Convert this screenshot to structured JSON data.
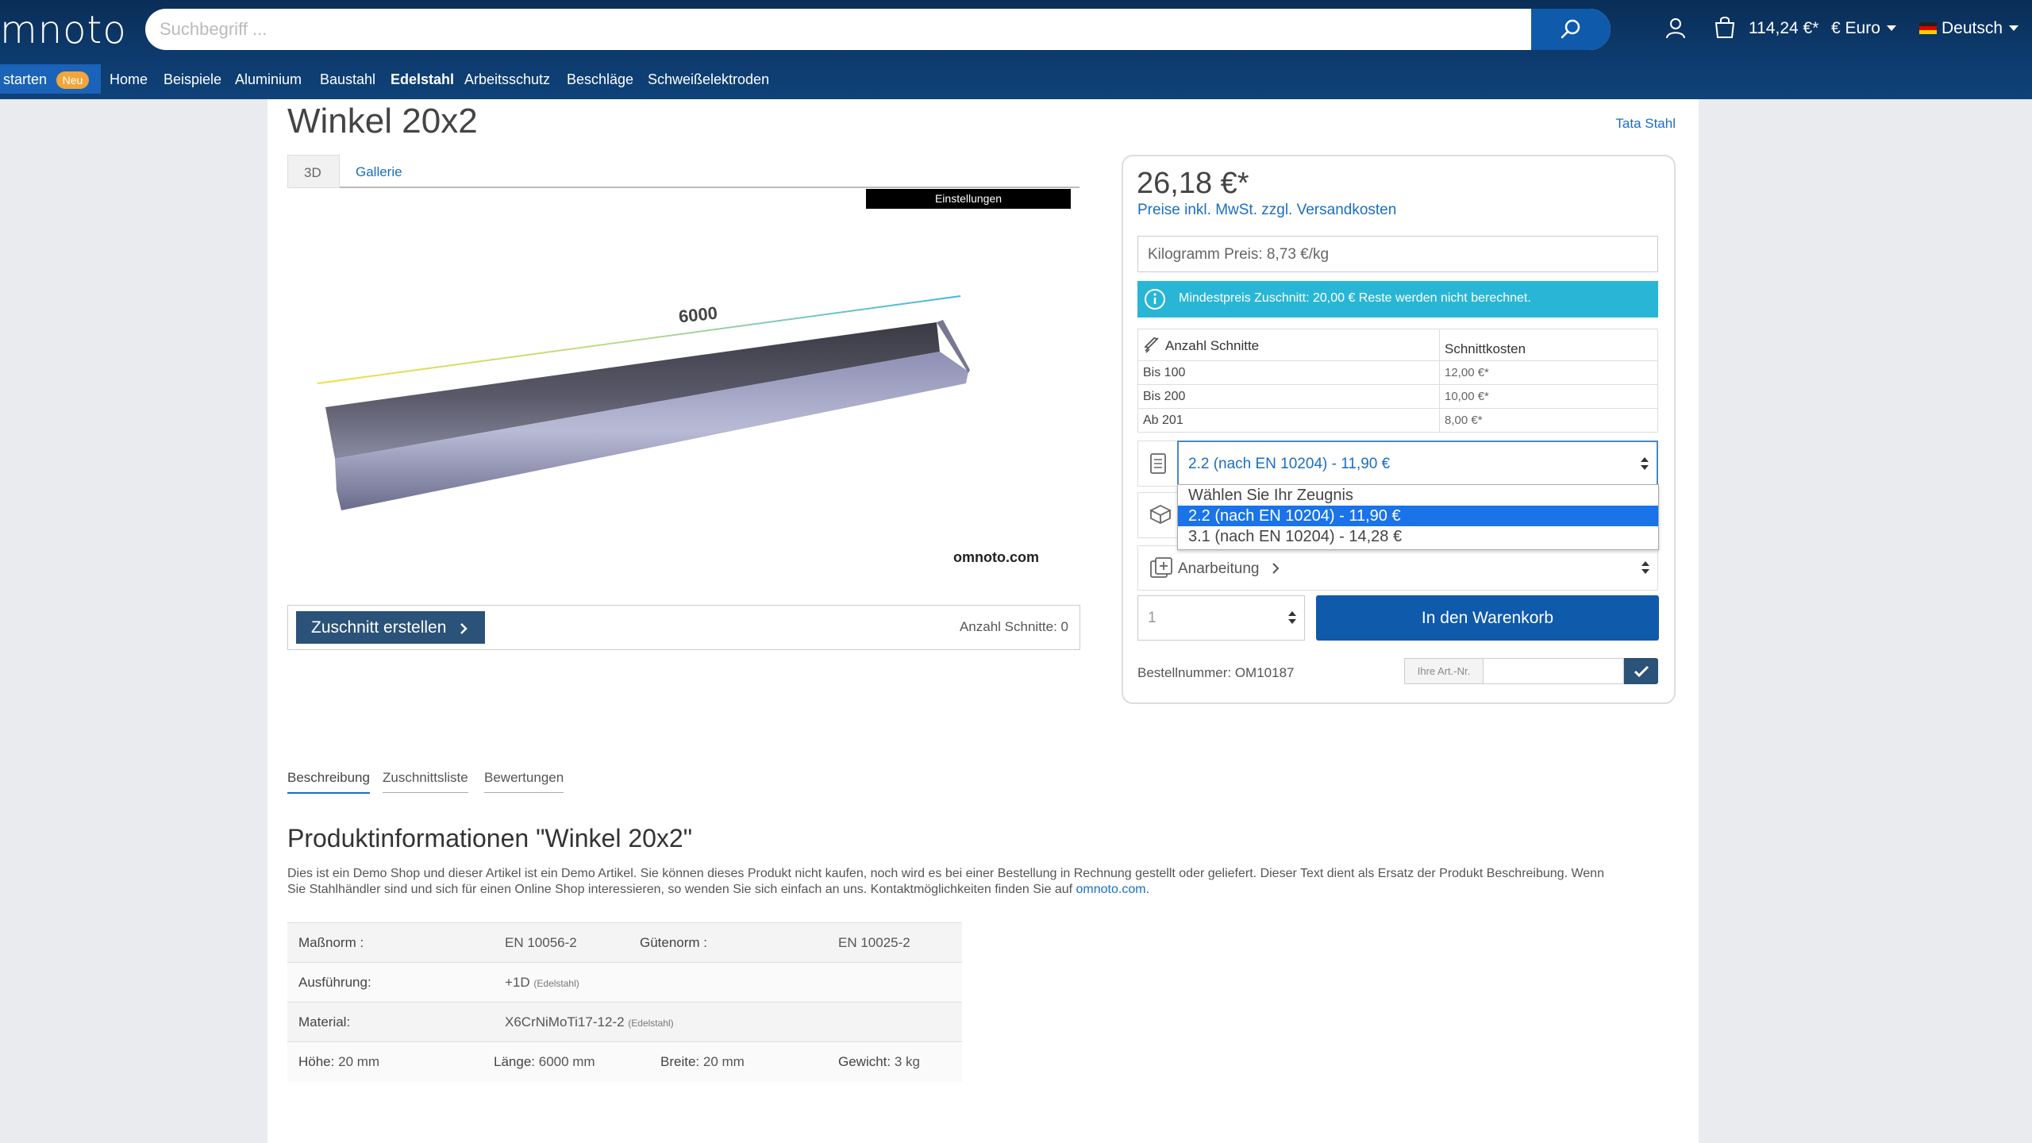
{
  "header": {
    "logo": "mnoto",
    "search_placeholder": "Suchbegriff ...",
    "cart_total": "114,24 €*",
    "currency": "€ Euro",
    "language": "Deutsch"
  },
  "nav": {
    "start_label": "starten",
    "badge": "Neu",
    "items": [
      "Home",
      "Beispiele",
      "Aluminium",
      "Baustahl",
      "Edelstahl",
      "Arbeitsschutz",
      "Beschläge",
      "Schweißelektroden"
    ],
    "active": "Edelstahl"
  },
  "product": {
    "title": "Winkel 20x2",
    "manufacturer": "Tata Stahl",
    "view_tabs": [
      "3D",
      "Gallerie"
    ],
    "settings_label": "Einstellungen",
    "dimension_label": "6000",
    "watermark": "omnoto.com",
    "cut_button": "Zuschnitt erstellen",
    "cut_count": "Anzahl Schnitte: 0"
  },
  "buybox": {
    "price": "26,18 €*",
    "price_note": "Preise inkl. MwSt. zzgl. Versandkosten",
    "kg_price": "Kilogramm Preis: 8,73 €/kg",
    "info": "Mindestpreis Zuschnitt: 20,00 € Reste werden nicht berechnet.",
    "cost_table": {
      "headers": [
        "Anzahl Schnitte",
        "Schnittkosten"
      ],
      "rows": [
        [
          "Bis 100",
          "12,00 €*"
        ],
        [
          "Bis 200",
          "10,00 €*"
        ],
        [
          "Ab 201",
          "8,00 €*"
        ]
      ]
    },
    "certificate_selected": "2.2 (nach EN 10204) - 11,90 €",
    "certificate_options": [
      "Wählen Sie Ihr Zeugnis",
      "2.2 (nach EN 10204) - 11,90 €",
      "3.1 (nach EN 10204) - 14,28 €"
    ],
    "processing_label": "Anarbeitung",
    "quantity": "1",
    "cart_button": "In den Warenkorb",
    "order_number": "Bestellnummer: OM10187",
    "art_nr_label": "Ihre Art.-Nr."
  },
  "details": {
    "tabs": [
      "Beschreibung",
      "Zuschnittsliste",
      "Bewertungen"
    ],
    "heading": "Produktinformationen \"Winkel 20x2\"",
    "text": "Dies ist ein Demo Shop und dieser Artikel ist ein Demo Artikel. Sie können dieses Produkt nicht kaufen, noch wird es bei einer Bestellung in Rechnung gestellt oder geliefert. Dieser Text dient als Ersatz der Produkt Beschreibung. Wenn Sie Stahlhändler sind und sich für einen Online Shop interessieren, so wenden Sie sich einfach an uns. Kontaktmöglichkeiten finden Sie auf",
    "link": "omnoto.com",
    "link_suffix": ".",
    "spec": {
      "massnorm_label": "Maßnorm :",
      "massnorm": "EN 10056-2",
      "guetenorm_label": "Gütenorm :",
      "guetenorm": "EN 10025-2",
      "ausfuehrung_label": "Ausführung:",
      "ausfuehrung": "+1D",
      "ausfuehrung_note": "(Edelstahl)",
      "material_label": "Material:",
      "material": "X6CrNiMoTi17-12-2",
      "material_note": "(Edelstahl)",
      "hoehe_label": "Höhe:",
      "hoehe": "20 mm",
      "laenge_label": "Länge:",
      "laenge": "6000 mm",
      "breite_label": "Breite:",
      "breite": "20 mm",
      "gewicht_label": "Gewicht:",
      "gewicht": "3 kg"
    }
  },
  "colors": {
    "header_bg": "#0d3a6d",
    "accent": "#0f5aab",
    "info": "#29b6d6",
    "badge": "#f2a63a"
  }
}
